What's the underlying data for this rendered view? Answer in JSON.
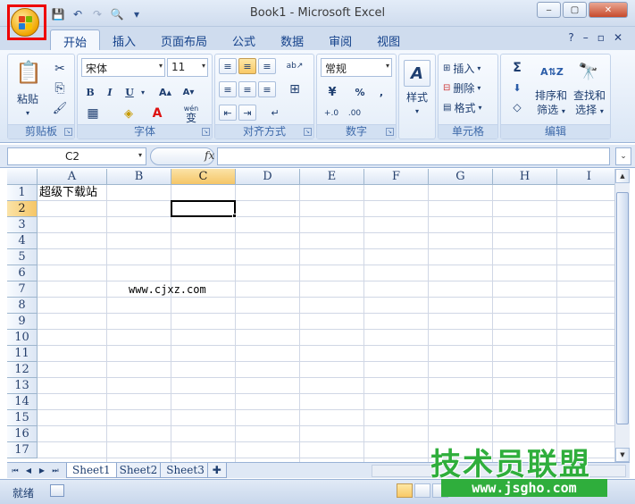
{
  "window": {
    "title": "Book1 - Microsoft Excel",
    "minimize": "‒",
    "maximize": "▢",
    "close": "✕"
  },
  "qat": {
    "save_icon": "💾",
    "undo_icon": "↶",
    "redo_icon": "↷",
    "preview_icon": "🔍",
    "customize_icon": "▾"
  },
  "tabs": [
    "开始",
    "插入",
    "页面布局",
    "公式",
    "数据",
    "审阅",
    "视图"
  ],
  "ribbon_right": {
    "help": "?",
    "min": "–",
    "restore": "▫",
    "close": "✕"
  },
  "clipboard": {
    "label": "剪贴板",
    "paste": "粘贴",
    "paste_icon": "📋",
    "paste_arrow": "▾",
    "cut_icon": "✂",
    "copy_icon": "⎘",
    "format_painter_icon": "🖌"
  },
  "font": {
    "label": "字体",
    "font_name": "宋体",
    "font_size": "11",
    "grow": "A▴",
    "shrink": "A▾",
    "bold": "B",
    "italic": "I",
    "underline": "U",
    "underline_arrow": "▾",
    "border_icon": "▦",
    "fill_icon": "◈",
    "font_color_icon": "A",
    "phonetic_top": "wén",
    "phonetic_icon": "变",
    "dropdown": "▾"
  },
  "alignment": {
    "label": "对齐方式",
    "top": "≡",
    "middle": "≡",
    "bottom": "≡",
    "orientation": "ab↗",
    "left": "≡",
    "center": "≡",
    "right": "≡",
    "merge": "⊞",
    "decrease_indent": "⇤",
    "increase_indent": "⇥",
    "wrap": "↵"
  },
  "number": {
    "label": "数字",
    "format": "常规",
    "currency": "¥",
    "percent": "%",
    "comma": ",",
    "inc_decimal": "+.0",
    "dec_decimal": ".00"
  },
  "styles": {
    "label": "样式",
    "icon": "A",
    "arrow": "▾"
  },
  "cells": {
    "label": "单元格",
    "insert": "插入",
    "delete": "删除",
    "format": "格式",
    "arrow": "▾"
  },
  "editing": {
    "label": "编辑",
    "sum_icon": "Σ",
    "fill_icon": "⬇",
    "clear_icon": "◇",
    "sort_filter_1": "排序和",
    "sort_filter_2": "筛选",
    "find_select_1": "查找和",
    "find_select_2": "选择",
    "sort_icon": "A⇅Z",
    "find_icon": "🔭",
    "arrow": "▾"
  },
  "formula_bar": {
    "name_box": "C2",
    "name_arrow": "▾",
    "fx": "fx",
    "content": "",
    "expand": "⌄"
  },
  "grid": {
    "columns": [
      "A",
      "B",
      "C",
      "D",
      "E",
      "F",
      "G",
      "H",
      "I"
    ],
    "rows": [
      "1",
      "2",
      "3",
      "4",
      "5",
      "6",
      "7",
      "8",
      "9",
      "10",
      "11",
      "12",
      "13",
      "14",
      "15",
      "16",
      "17"
    ],
    "selected_cell": "C2",
    "cells": {
      "A1": "超级下载站",
      "B7": "www.cjxz.com"
    }
  },
  "scroll": {
    "up": "▲",
    "down": "▼"
  },
  "sheets": {
    "nav": [
      "⏮",
      "◀",
      "▶",
      "⏭"
    ],
    "tabs": [
      "Sheet1",
      "Sheet2",
      "Sheet3"
    ],
    "active": "Sheet1",
    "insert_icon": "✚"
  },
  "status": {
    "text": "就绪"
  },
  "watermark": {
    "title": "技术员联盟",
    "url": "www.jsgho.com"
  }
}
